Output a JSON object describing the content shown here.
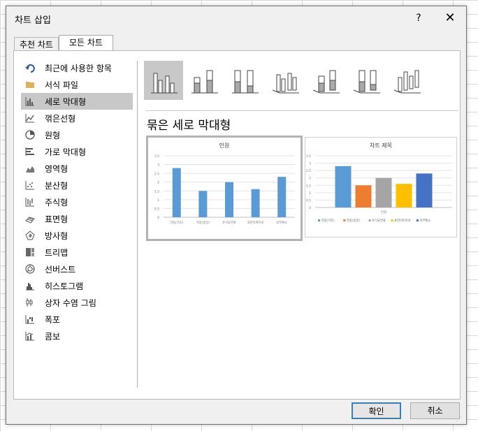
{
  "dialog": {
    "title": "차트 삽입",
    "help": "?",
    "close": "✕"
  },
  "tabs": [
    {
      "label": "추천 차트"
    },
    {
      "label": "모든 차트"
    }
  ],
  "sidebar": {
    "items": [
      {
        "label": "최근에 사용한 항목",
        "icon": "recent-undo-icon"
      },
      {
        "label": "서식 파일",
        "icon": "folder-icon"
      },
      {
        "label": "세로 막대형",
        "icon": "column-chart-icon",
        "selected": true
      },
      {
        "label": "꺾은선형",
        "icon": "line-chart-icon"
      },
      {
        "label": "원형",
        "icon": "pie-chart-icon"
      },
      {
        "label": "가로 막대형",
        "icon": "bar-chart-icon"
      },
      {
        "label": "영역형",
        "icon": "area-chart-icon"
      },
      {
        "label": "분산형",
        "icon": "scatter-chart-icon"
      },
      {
        "label": "주식형",
        "icon": "stock-chart-icon"
      },
      {
        "label": "표면형",
        "icon": "surface-chart-icon"
      },
      {
        "label": "방사형",
        "icon": "radar-chart-icon"
      },
      {
        "label": "트리맵",
        "icon": "treemap-chart-icon"
      },
      {
        "label": "선버스트",
        "icon": "sunburst-chart-icon"
      },
      {
        "label": "히스토그램",
        "icon": "histogram-chart-icon"
      },
      {
        "label": "상자 수염 그림",
        "icon": "box-whisker-chart-icon"
      },
      {
        "label": "폭포",
        "icon": "waterfall-chart-icon"
      },
      {
        "label": "콤보",
        "icon": "combo-chart-icon"
      }
    ]
  },
  "subtypes": [
    {
      "name": "clustered-column-icon",
      "selected": true
    },
    {
      "name": "stacked-column-icon"
    },
    {
      "name": "percent-stacked-column-icon"
    },
    {
      "name": "3d-clustered-column-icon"
    },
    {
      "name": "3d-stacked-column-icon"
    },
    {
      "name": "3d-percent-stacked-column-icon"
    },
    {
      "name": "3d-column-icon"
    }
  ],
  "subtype_title": "묶은 세로 막대형",
  "colors": {
    "accent_selected_bg": "#c8c8c8",
    "ok_border": "#3c7fb1",
    "bar_blue": "#5b9bd5",
    "bar_orange": "#ed7d31",
    "bar_gray": "#a5a5a5",
    "bar_yellow": "#ffc000",
    "bar_darkblue": "#4472c4"
  },
  "chart_data": [
    {
      "type": "bar",
      "title": "인원",
      "categories": [
        "약용(기초)",
        "약용(중앙)",
        "유식요연표",
        "표면이퍼프로",
        "의부예소"
      ],
      "values": [
        2.8,
        1.5,
        2.0,
        1.6,
        2.3
      ],
      "ylim": [
        0,
        3
      ],
      "yticks": [
        "3.5",
        "3",
        "2.5",
        "2",
        "1.5",
        "1",
        "0.5",
        "0"
      ],
      "series_colors": [
        "#5b9bd5"
      ],
      "grid": true
    },
    {
      "type": "bar",
      "title": "차트 제목",
      "categories": [
        "인원"
      ],
      "series": [
        {
          "name": "약용(기초)",
          "values": [
            2.8
          ]
        },
        {
          "name": "약용(중앙)",
          "values": [
            1.5
          ]
        },
        {
          "name": "유식요연표",
          "values": [
            2.0
          ]
        },
        {
          "name": "표면이퍼프로",
          "values": [
            1.6
          ]
        },
        {
          "name": "의부예소",
          "values": [
            2.3
          ]
        }
      ],
      "ylim": [
        0,
        3
      ],
      "yticks": [
        "3.5",
        "3",
        "2.5",
        "2",
        "1.5",
        "1",
        "0.5",
        "0"
      ],
      "series_colors": [
        "#5b9bd5",
        "#ed7d31",
        "#a5a5a5",
        "#ffc000",
        "#4472c4"
      ],
      "legend": "bottom",
      "grid": true
    }
  ],
  "buttons": {
    "ok": "확인",
    "cancel": "취소"
  }
}
